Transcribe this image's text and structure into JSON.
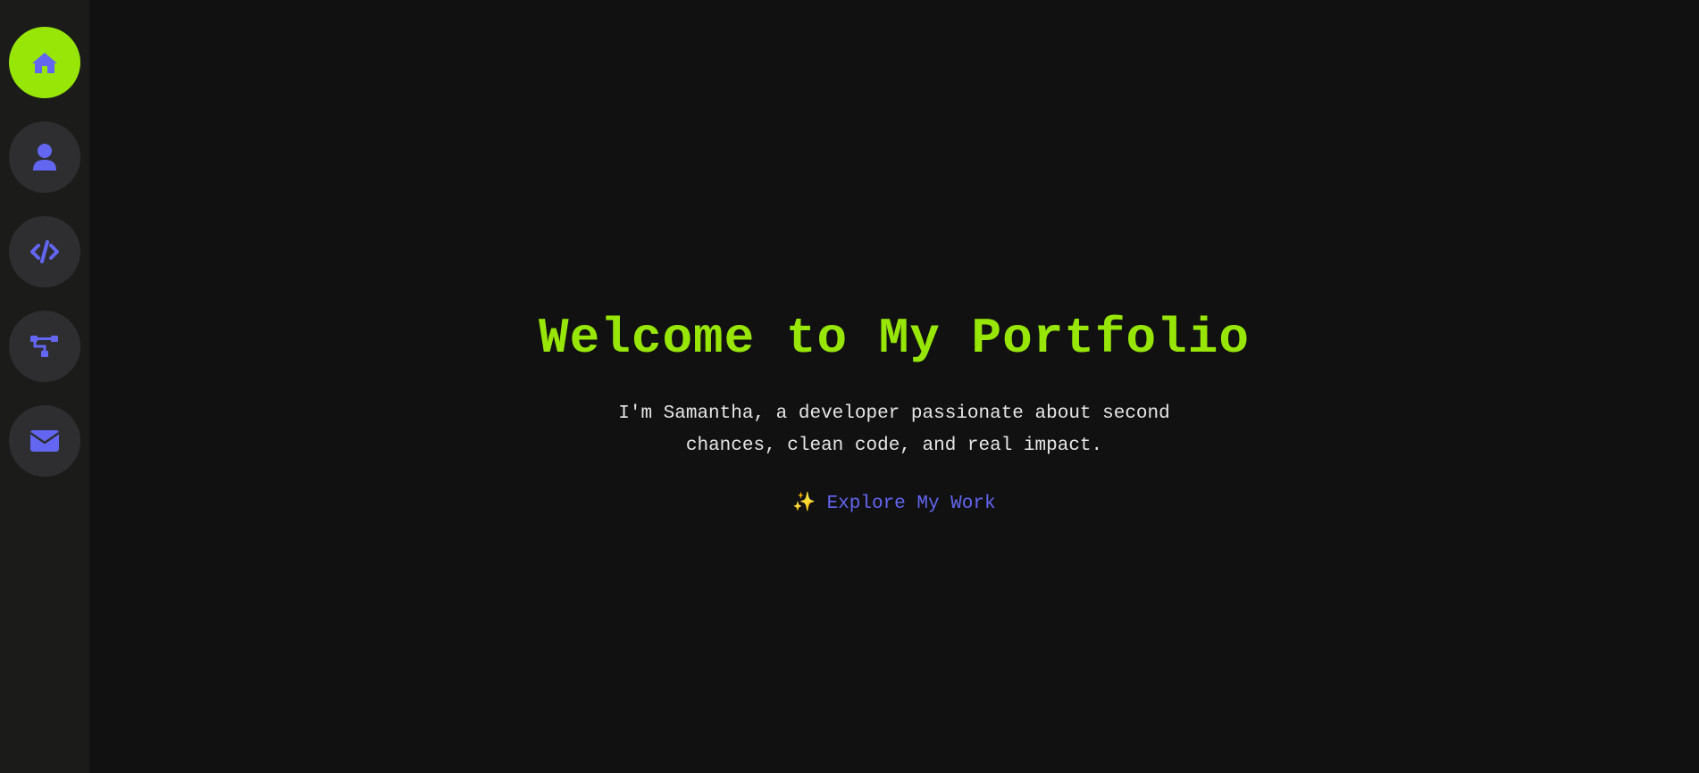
{
  "sidebar": {
    "items": [
      {
        "icon": "home-icon",
        "active": true
      },
      {
        "icon": "user-icon",
        "active": false
      },
      {
        "icon": "code-icon",
        "active": false
      },
      {
        "icon": "sitemap-icon",
        "active": false
      },
      {
        "icon": "envelope-icon",
        "active": false
      }
    ]
  },
  "hero": {
    "title": "Welcome to My Portfolio",
    "intro": "I'm Samantha, a developer passionate about second chances, clean code, and real impact.",
    "cta": {
      "icon": "sparkles-icon",
      "glyph": "✨",
      "label": "Explore My Work"
    }
  },
  "colors": {
    "accent": "#97e607",
    "link": "#6266f1",
    "icon": "#6266f1",
    "background": "#111111",
    "sidebar": "#1b1c1a",
    "nav_button": "#2e2e30",
    "body_text": "#e6e6e6"
  }
}
